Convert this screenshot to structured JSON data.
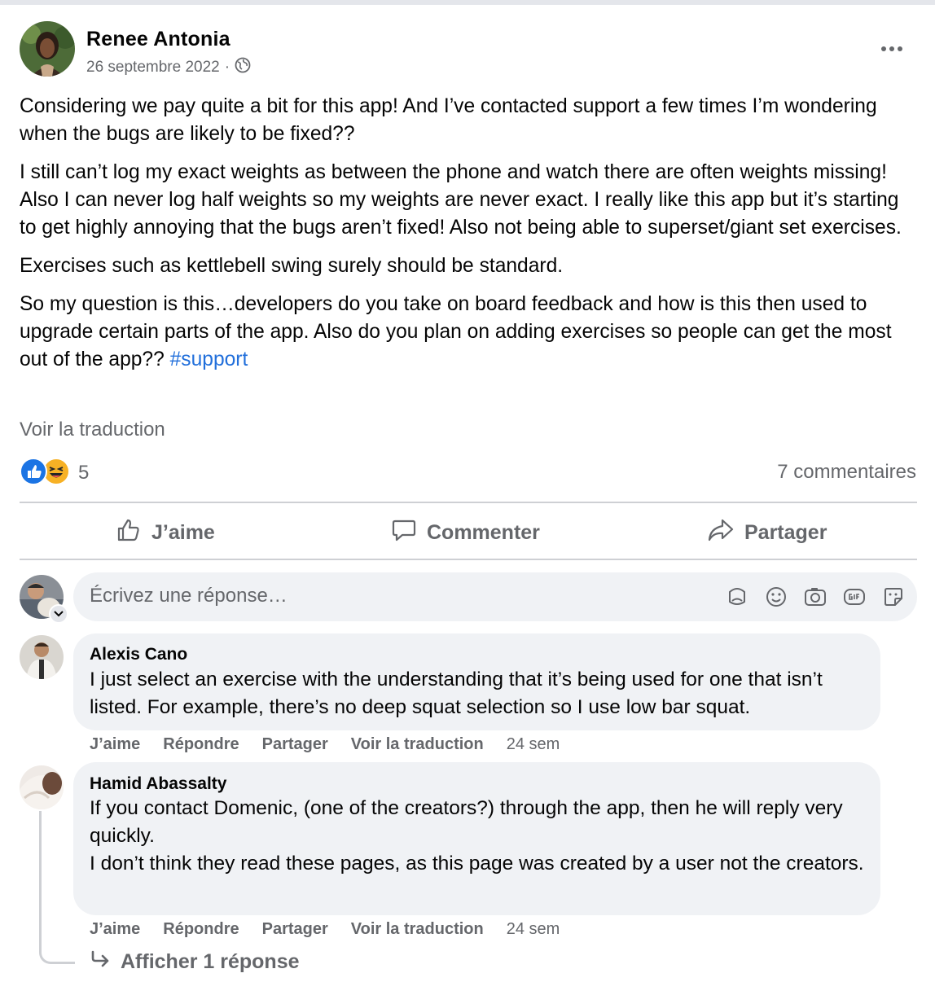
{
  "post": {
    "author": "Renee Antonia",
    "date": "26 septembre 2022",
    "meta_separator": "·",
    "paragraphs": [
      "Considering we pay quite a bit for this app! And I’ve contacted support a few times I’m wondering when the bugs are likely to be fixed??",
      "I still can’t log my exact weights as between the phone and watch  there are often weights missing! Also I can never log half weights so my weights are never exact. I really like this app but it’s starting to get highly annoying that the bugs aren’t fixed! Also not being able to superset/giant set exercises.",
      "Exercises such as kettlebell swing surely should be standard.",
      "So my question is this…developers do you take on board feedback and how is this then used to upgrade certain parts of the app. Also do you plan on adding exercises so people can get the most out of the app??"
    ],
    "hashtag": "#support",
    "translate_label": "Voir la traduction",
    "reaction_count": "5",
    "reaction_icons": [
      "like-icon",
      "haha-icon"
    ],
    "comments_count_label": "7 commentaires"
  },
  "actions": {
    "like": "J’aime",
    "comment": "Commenter",
    "share": "Partager"
  },
  "reply_input": {
    "placeholder": "Écrivez une réponse…",
    "tools": [
      "avatar-sticker-icon",
      "emoji-icon",
      "camera-icon",
      "gif-icon",
      "sticker-icon"
    ]
  },
  "comments": [
    {
      "author": "Alexis Cano",
      "text": "I just select an exercise with the understanding that it’s being used for one that isn’t listed. For example, there’s no deep squat selection so I use low bar squat.",
      "actions": {
        "like": "J’aime",
        "reply": "Répondre",
        "share": "Partager",
        "translate": "Voir la traduction",
        "time": "24 sem"
      }
    },
    {
      "author": "Hamid Abassalty",
      "lines": [
        "If you contact Domenic, (one of the creators?) through the app, then he will reply very quickly.",
        "I don’t think they read these pages, as this page was created by a user not the creators."
      ],
      "actions": {
        "like": "J’aime",
        "reply": "Répondre",
        "share": "Partager",
        "translate": "Voir la traduction",
        "time": "24 sem"
      },
      "more_replies": "Afficher 1 réponse"
    }
  ],
  "colors": {
    "link_blue": "#216fdb",
    "secondary_text": "#65676b",
    "bubble_bg": "#f0f2f5",
    "divider": "#ced0d4"
  }
}
